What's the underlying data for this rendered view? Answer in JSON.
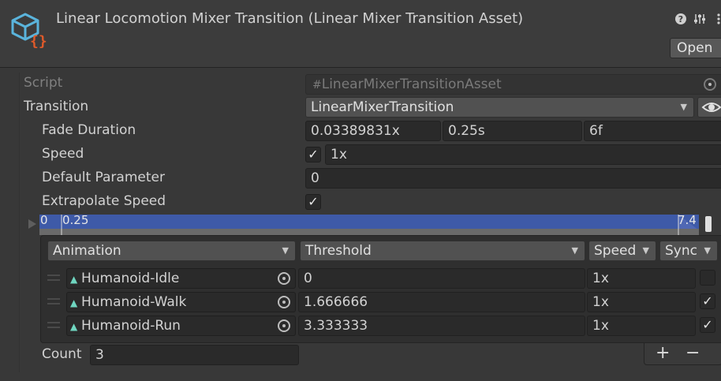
{
  "header": {
    "title": "Linear Locomotion Mixer Transition (Linear Mixer Transition Asset)",
    "help_icon": "question-icon",
    "settings_icon": "sliders-icon",
    "more_icon": "kebab-icon",
    "open_label": "Open"
  },
  "fields": {
    "script_label": "Script",
    "script_value": "LinearMixerTransitionAsset",
    "transition_label": "Transition",
    "transition_value": "LinearMixerTransition",
    "fade_label": "Fade Duration",
    "fade_normalized": "0.03389831x",
    "fade_seconds": "0.25s",
    "fade_frames": "6f",
    "speed_label": "Speed",
    "speed_checked": true,
    "speed_value": "1x",
    "default_param_label": "Default Parameter",
    "default_param_value": "0",
    "extrapolate_label": "Extrapolate Speed",
    "extrapolate_checked": true
  },
  "timeline": {
    "start_label": "0",
    "fade_label": "0.25",
    "end_label": "7.4",
    "colors": {
      "fill": "#3e5aa8",
      "track": "#5a5a5a"
    }
  },
  "table": {
    "headers": {
      "animation": "Animation",
      "threshold": "Threshold",
      "speed": "Speed",
      "sync": "Sync"
    },
    "rows": [
      {
        "animation": "Humanoid-Idle",
        "threshold": "0",
        "speed": "1x",
        "sync": false
      },
      {
        "animation": "Humanoid-Walk",
        "threshold": "1.666666",
        "speed": "1x",
        "sync": true
      },
      {
        "animation": "Humanoid-Run",
        "threshold": "3.333333",
        "speed": "1x",
        "sync": true
      }
    ],
    "count_label": "Count",
    "count_value": "3",
    "add_label": "+",
    "remove_label": "−"
  }
}
